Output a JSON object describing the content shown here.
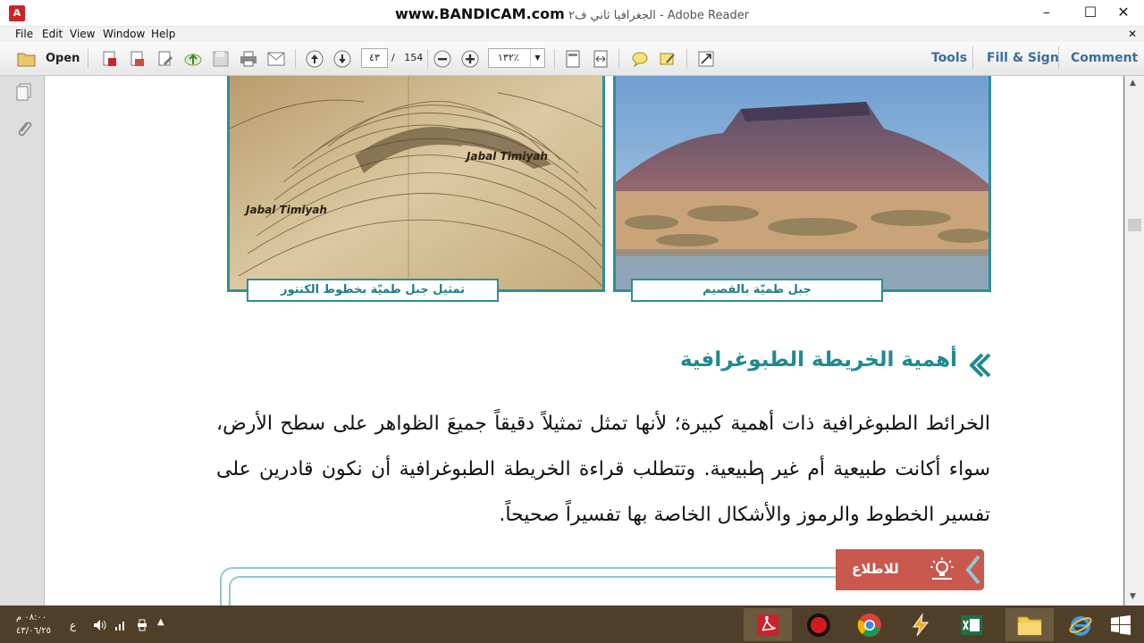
{
  "window": {
    "title": "الجغرافيا ثاني ف٢ - Adobe Reader",
    "watermark": "www.BANDICAM.com",
    "minimize": "–",
    "maximize": "☐",
    "close": "✕"
  },
  "menu": [
    "File",
    "Edit",
    "View",
    "Window",
    "Help"
  ],
  "toolbar": {
    "open_label": "Open",
    "page_current": "٤٣",
    "page_separator": "/",
    "page_total": "154",
    "zoom_value": "١٣٢٪",
    "tools_label": "Tools",
    "fill_sign_label": "Fill & Sign",
    "comment_label": "Comment"
  },
  "document": {
    "photo_left_caption": "تمثيل جبل طميّة بخطوط الكنتور",
    "photo_left_label_1": "Jabal Timiyah",
    "photo_left_label_2": "Jabal Timiyah",
    "photo_right_caption": "جبل طميّة بالقصيم",
    "section_heading": "أهمية الخريطة الطبوغرافية",
    "paragraph": "الخرائط الطبوغرافية ذات أهمية كبيرة؛ لأنها تمثل تمثيلاً دقيقاً جميعَ الظواهر على سطح الأرض، سواء أكانت طبيعية أم غير طبيعية. وتتطلب قراءة الخريطة الطبوغرافية أن نكون قادرين على تفسير الخطوط والرموز والأشكال الخاصة بها تفسيراً صحيحاً.",
    "info_tab_label": "للاطلاع"
  },
  "taskbar": {
    "clock_time": "٠٨:٠٠ م",
    "clock_date": "٤٣/٠٦/٢٥",
    "lang": "ع"
  },
  "colors": {
    "accent_teal": "#2f8f95",
    "heading_teal": "#1e8a8f",
    "info_red": "#c9584e",
    "taskbar": "#4f3f28",
    "link_blue": "#3a6e9e"
  }
}
